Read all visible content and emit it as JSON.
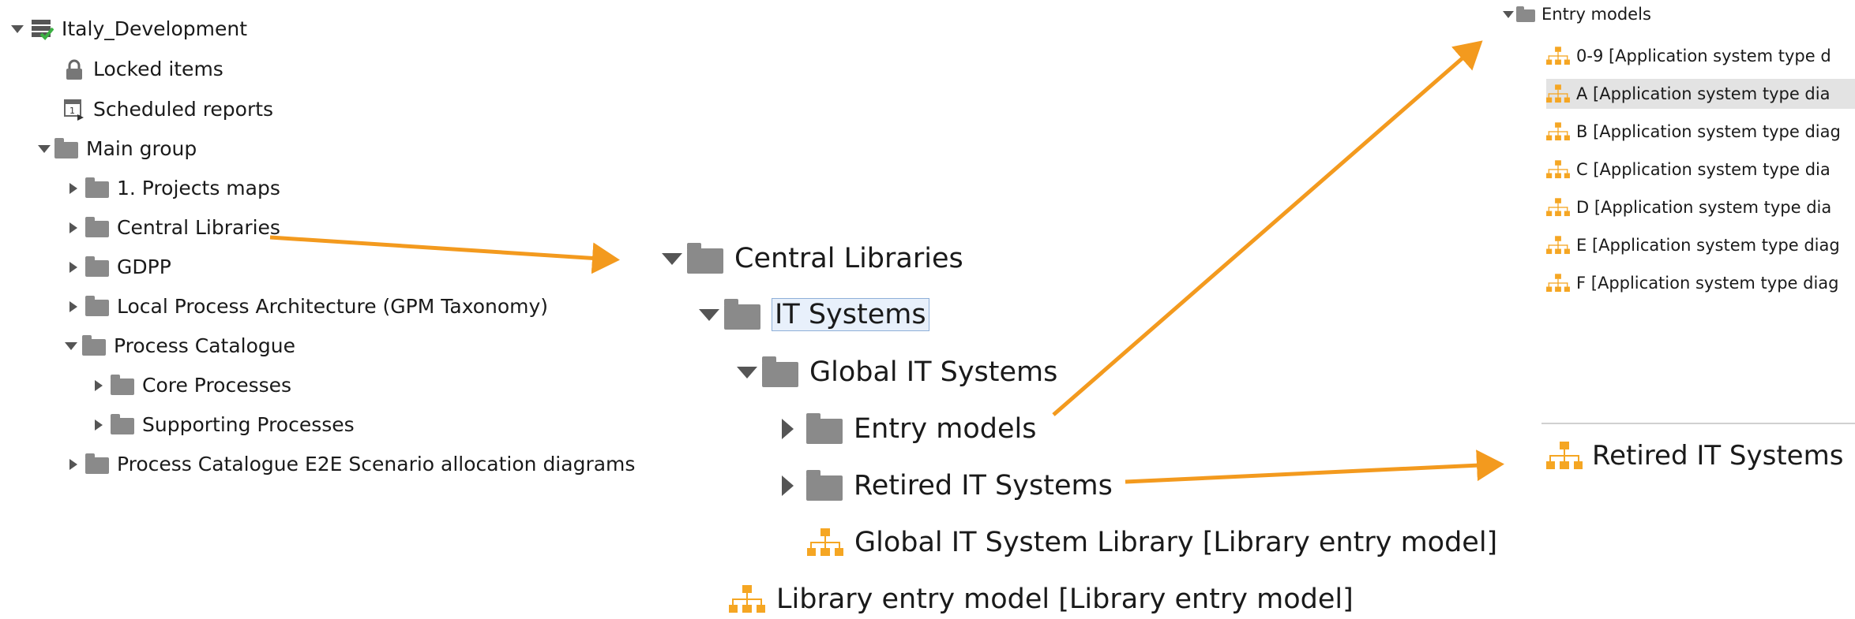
{
  "left_tree": {
    "root": "Italy_Development",
    "locked": "Locked items",
    "scheduled": "Scheduled reports",
    "main_group": "Main group",
    "projects_maps": "1. Projects maps",
    "central_libraries": "Central Libraries",
    "gdpp": "GDPP",
    "local_process": "Local Process Architecture (GPM Taxonomy)",
    "process_catalogue": "Process Catalogue",
    "core": "Core Processes",
    "supporting": "Supporting Processes",
    "e2e": "Process Catalogue E2E Scenario allocation diagrams"
  },
  "middle_tree": {
    "central_libraries": "Central Libraries",
    "it_systems": "IT Systems",
    "global_it": "Global IT Systems",
    "entry_models": "Entry models",
    "retired": "Retired IT Systems",
    "global_library": "Global IT System Library [Library entry model]",
    "library_entry": "Library entry model [Library entry model]"
  },
  "right_panel": {
    "entry_models": "Entry models",
    "items": [
      "0-9 [Application system type d",
      "A [Application system type dia",
      "B [Application system type diag",
      "C [Application system type dia",
      "D [Application system type dia",
      "E [Application system type diag",
      "F [Application system type diag"
    ],
    "retired": "Retired IT Systems"
  },
  "colors": {
    "arrow": "#f39a1e",
    "model_icon": "#f5a623",
    "folder": "#8a8a8a",
    "selection": "#e8f0fb"
  }
}
